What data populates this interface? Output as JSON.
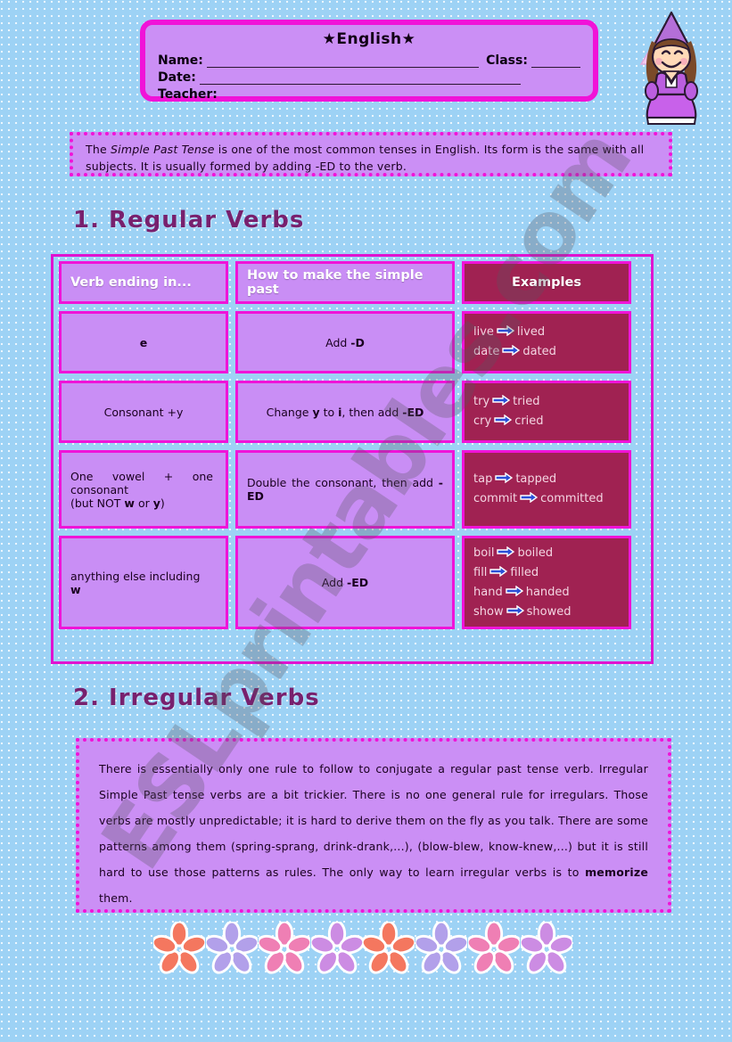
{
  "page": {
    "background_color": "#9dd2f5",
    "accent_magenta": "#f013d8",
    "panel_purple": "#cb8ff5",
    "dark_magenta": "#a02252",
    "heading_purple": "#78206e"
  },
  "watermark": {
    "text": "ESLprintables.com"
  },
  "header": {
    "title": "★English★",
    "fields": [
      {
        "label": "Name:",
        "value": ""
      },
      {
        "label": "Class:",
        "value": ""
      },
      {
        "label": "Date:",
        "value": ""
      },
      {
        "label": "Teacher:",
        "value": ""
      }
    ],
    "name_label": "Name:",
    "class_label": "Class:",
    "date_label": "Date:",
    "teacher_label": "Teacher:"
  },
  "intro": {
    "before_italic": "The ",
    "italic": "Simple Past Tense",
    "after_italic": " is one of the most common tenses in English. Its form is the same with all subjects. It is usually formed by adding -ED to the verb."
  },
  "sections": {
    "regular_heading": "1. Regular Verbs",
    "irregular_heading": "2. Irregular Verbs"
  },
  "table": {
    "headers": {
      "col1": "Verb ending in...",
      "col2": "How to make the simple past",
      "col3": "Examples"
    },
    "rows": [
      {
        "ending": "e",
        "ending_bold": true,
        "rule_pre": "Add ",
        "rule_bold": "-D",
        "rule_post": "",
        "examples": [
          {
            "base": "live",
            "past": "lived"
          },
          {
            "base": "date",
            "past": "dated"
          }
        ]
      },
      {
        "ending": "Consonant +y",
        "rule_pre": "Change ",
        "rule_bold": "y",
        "rule_mid": " to ",
        "rule_bold2": "i",
        "rule_post": ", then add ",
        "rule_bold3": "-ED",
        "examples": [
          {
            "base": "try",
            "past": "tried"
          },
          {
            "base": "cry",
            "past": "cried"
          }
        ]
      },
      {
        "ending_line1": "One  vowel  +  one consonant",
        "ending_line2_pre": "(but NOT ",
        "ending_line2_b1": "w",
        "ending_line2_mid": " or ",
        "ending_line2_b2": "y",
        "ending_line2_post": ")",
        "rule_pre": "Double  the  consonant,  then add ",
        "rule_bold": "-ED",
        "examples": [
          {
            "base": "tap",
            "past": "tapped"
          },
          {
            "base": "commit",
            "past": "committed"
          }
        ]
      },
      {
        "ending_line1": "anything else including",
        "ending_line2_b1": "w",
        "rule_pre": "Add ",
        "rule_bold": "-ED",
        "examples": [
          {
            "base": "boil",
            "past": "boiled"
          },
          {
            "base": "fill",
            "past": "filled"
          },
          {
            "base": "hand",
            "past": "handed"
          },
          {
            "base": "show",
            "past": "showed"
          }
        ]
      }
    ]
  },
  "irregular": {
    "part1": "There is essentially only one rule to follow to conjugate a regular past tense verb. Irregular Simple Past tense verbs are a bit trickier. There is no one general rule for irregulars. Those verbs are mostly unpredictable; it is hard to derive them on the fly as you talk. There are some patterns among them (spring-sprang, drink-drank,...), (blow-blew, know-knew,...) but it is still hard to use those patterns as rules. The only way to learn irregular verbs is to ",
    "bold": "memorize",
    "part2": " them."
  },
  "decorations": {
    "flower_colors": [
      "#f4775f",
      "#b2a0ea",
      "#ef7fb4",
      "#cc8ce3",
      "#f4775f",
      "#b2a0ea",
      "#ef7fb4",
      "#cc8ce3"
    ],
    "princess": {
      "hat_color": "#b46fd8",
      "veil_color": "#f2c9ef",
      "hair_color": "#7a4a2a",
      "dress_color": "#bb5ee0",
      "skin_color": "#ffd9b8"
    }
  }
}
